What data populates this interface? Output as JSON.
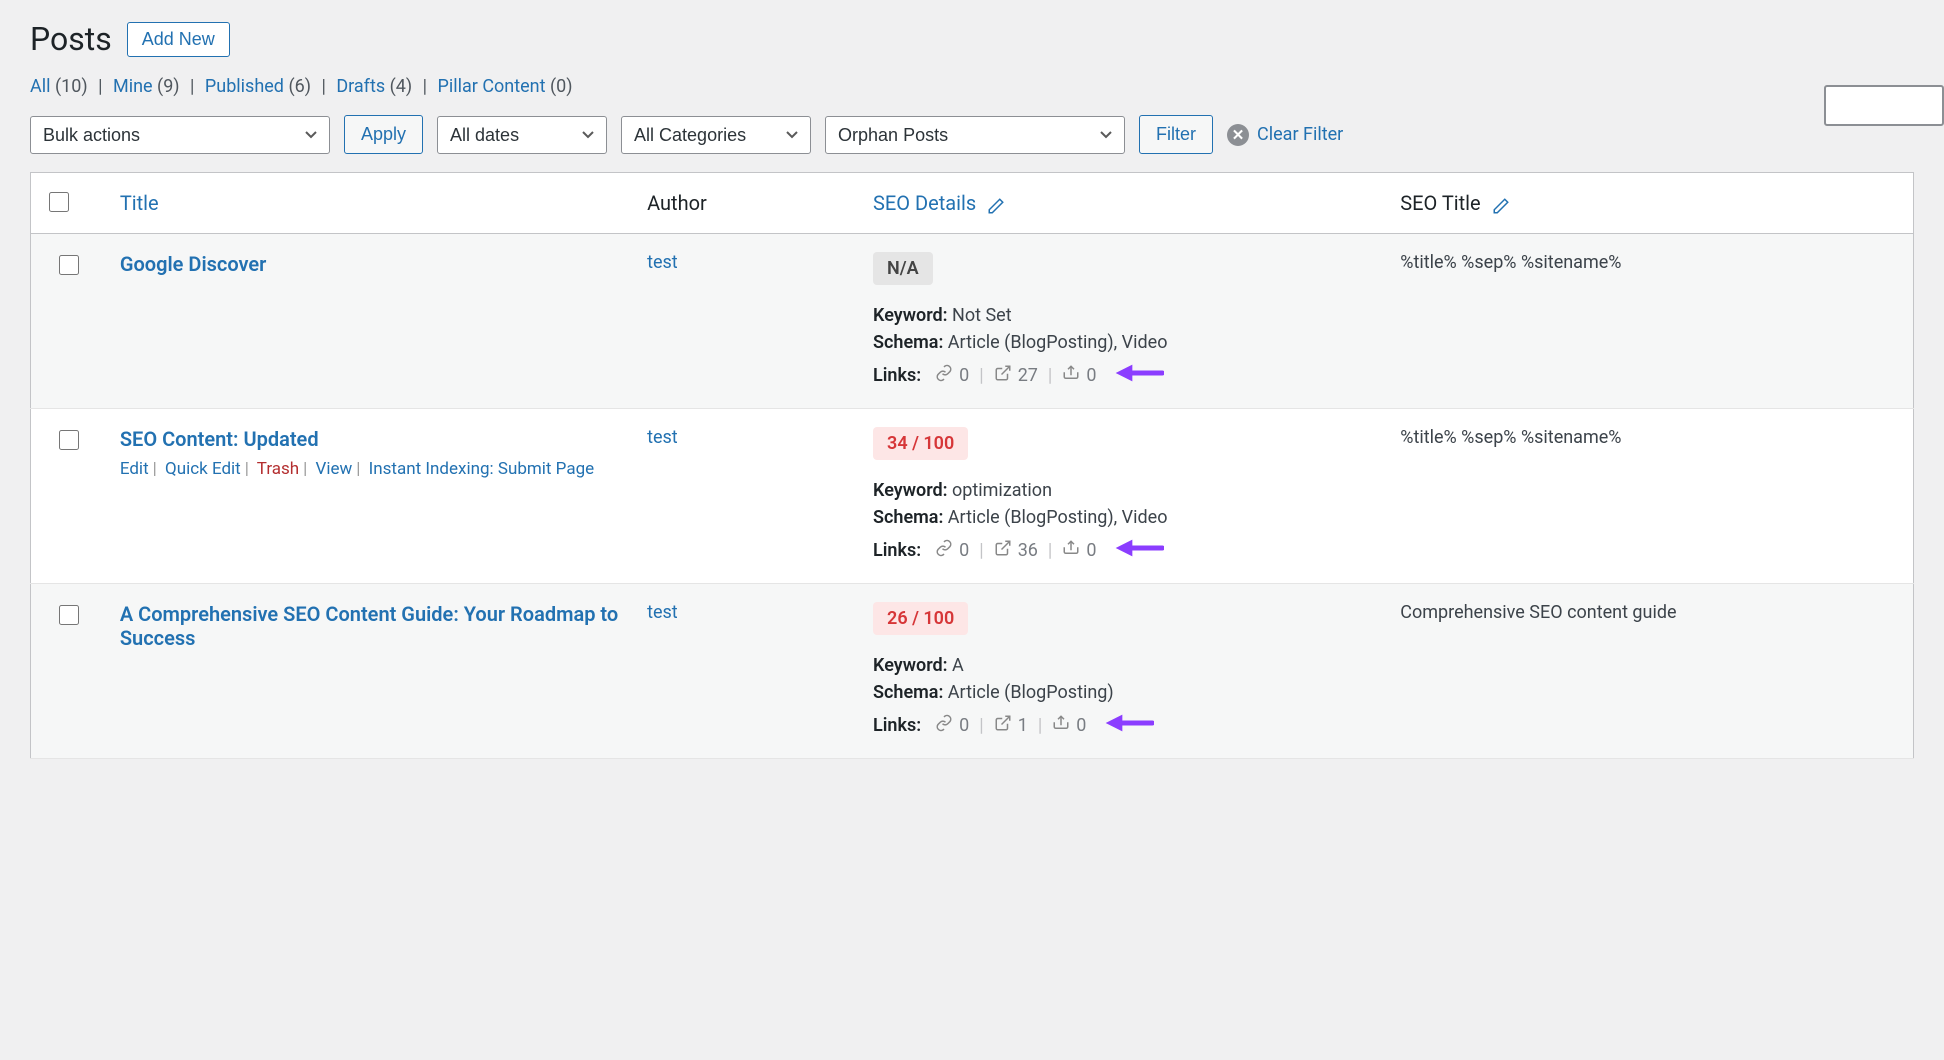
{
  "header": {
    "title": "Posts",
    "addNew": "Add New"
  },
  "filters": {
    "links": [
      {
        "label": "All",
        "count": "(10)"
      },
      {
        "label": "Mine",
        "count": "(9)"
      },
      {
        "label": "Published",
        "count": "(6)"
      },
      {
        "label": "Drafts",
        "count": "(4)"
      },
      {
        "label": "Pillar Content",
        "count": "(0)"
      }
    ]
  },
  "toolbar": {
    "bulkActions": "Bulk actions",
    "apply": "Apply",
    "dates": "All dates",
    "categories": "All Categories",
    "post": "Orphan Posts",
    "filter": "Filter",
    "clearFilter": "Clear Filter"
  },
  "columns": {
    "title": "Title",
    "author": "Author",
    "seoDetails": "SEO Details",
    "seoTitle": "SEO Title"
  },
  "labels": {
    "keyword": "Keyword:",
    "schema": "Schema:",
    "links": "Links:"
  },
  "rowActions": {
    "edit": "Edit",
    "quickEdit": "Quick Edit",
    "trash": "Trash",
    "view": "View",
    "instantIndexing": "Instant Indexing: Submit Page"
  },
  "rows": [
    {
      "title": "Google Discover",
      "author": "test",
      "score": "N/A",
      "scoreClass": "na",
      "keyword": "Not Set",
      "schema": "Article (BlogPosting), Video",
      "links": {
        "internal": "0",
        "external": "27",
        "incoming": "0"
      },
      "seoTitle": "%title% %sep% %sitename%",
      "showActions": false
    },
    {
      "title": "SEO Content: Updated",
      "author": "test",
      "score": "34 / 100",
      "scoreClass": "bad",
      "keyword": "optimization",
      "schema": "Article (BlogPosting), Video",
      "links": {
        "internal": "0",
        "external": "36",
        "incoming": "0"
      },
      "seoTitle": "%title% %sep% %sitename%",
      "showActions": true
    },
    {
      "title": "A Comprehensive SEO Content Guide: Your Roadmap to Success",
      "author": "test",
      "score": "26 / 100",
      "scoreClass": "bad",
      "keyword": "A",
      "schema": "Article (BlogPosting)",
      "links": {
        "internal": "0",
        "external": "1",
        "incoming": "0"
      },
      "seoTitle": "Comprehensive SEO content guide",
      "showActions": false
    }
  ]
}
